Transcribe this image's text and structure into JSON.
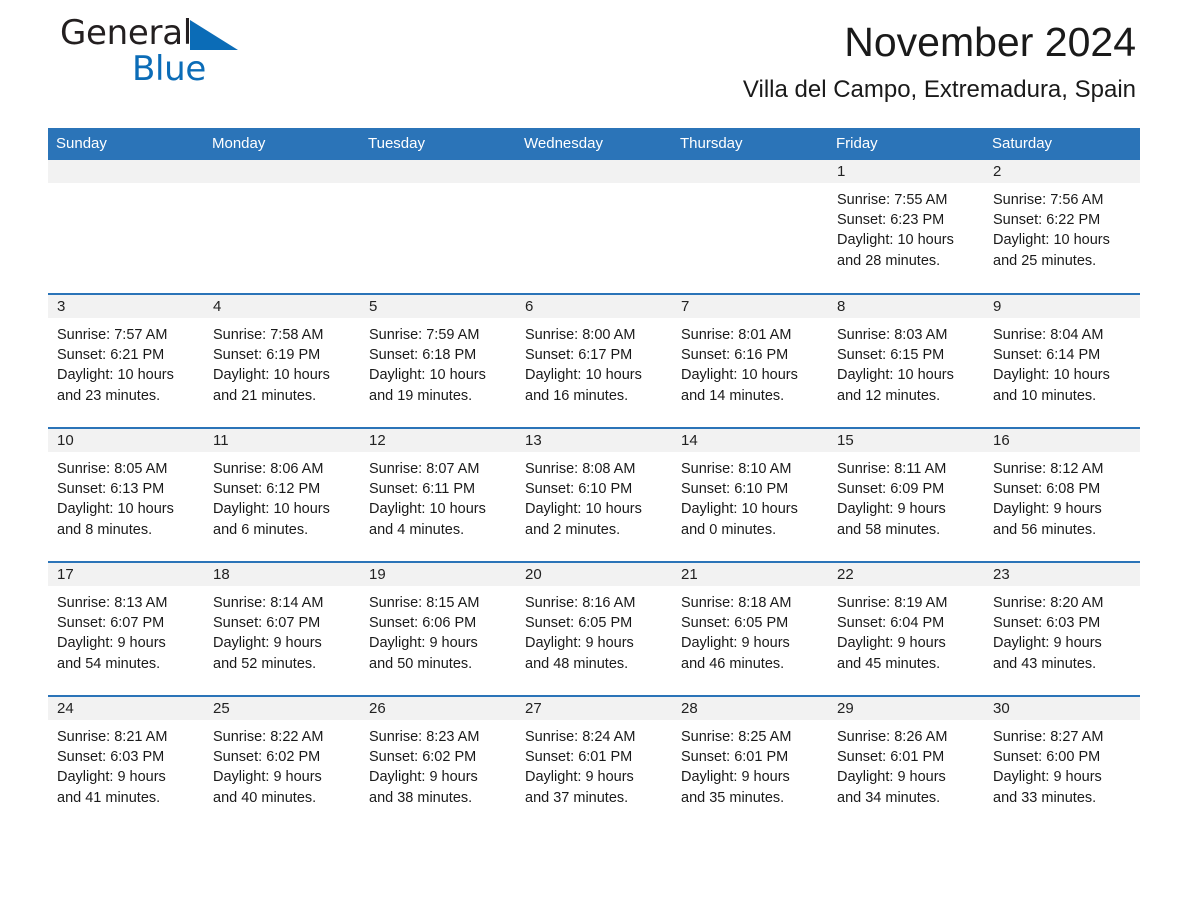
{
  "brand": {
    "name_part1": "General",
    "name_part2": "Blue",
    "accent_color": "#0b6cb7"
  },
  "header": {
    "title": "November 2024",
    "subtitle": "Villa del Campo, Extremadura, Spain"
  },
  "calendar": {
    "header_bg": "#2b74b8",
    "daynum_bg": "#f2f2f2",
    "weekdays": [
      "Sunday",
      "Monday",
      "Tuesday",
      "Wednesday",
      "Thursday",
      "Friday",
      "Saturday"
    ],
    "weeks": [
      [
        {
          "day": "",
          "sunrise": "",
          "sunset": "",
          "daylight1": "",
          "daylight2": ""
        },
        {
          "day": "",
          "sunrise": "",
          "sunset": "",
          "daylight1": "",
          "daylight2": ""
        },
        {
          "day": "",
          "sunrise": "",
          "sunset": "",
          "daylight1": "",
          "daylight2": ""
        },
        {
          "day": "",
          "sunrise": "",
          "sunset": "",
          "daylight1": "",
          "daylight2": ""
        },
        {
          "day": "",
          "sunrise": "",
          "sunset": "",
          "daylight1": "",
          "daylight2": ""
        },
        {
          "day": "1",
          "sunrise": "Sunrise: 7:55 AM",
          "sunset": "Sunset: 6:23 PM",
          "daylight1": "Daylight: 10 hours",
          "daylight2": "and 28 minutes."
        },
        {
          "day": "2",
          "sunrise": "Sunrise: 7:56 AM",
          "sunset": "Sunset: 6:22 PM",
          "daylight1": "Daylight: 10 hours",
          "daylight2": "and 25 minutes."
        }
      ],
      [
        {
          "day": "3",
          "sunrise": "Sunrise: 7:57 AM",
          "sunset": "Sunset: 6:21 PM",
          "daylight1": "Daylight: 10 hours",
          "daylight2": "and 23 minutes."
        },
        {
          "day": "4",
          "sunrise": "Sunrise: 7:58 AM",
          "sunset": "Sunset: 6:19 PM",
          "daylight1": "Daylight: 10 hours",
          "daylight2": "and 21 minutes."
        },
        {
          "day": "5",
          "sunrise": "Sunrise: 7:59 AM",
          "sunset": "Sunset: 6:18 PM",
          "daylight1": "Daylight: 10 hours",
          "daylight2": "and 19 minutes."
        },
        {
          "day": "6",
          "sunrise": "Sunrise: 8:00 AM",
          "sunset": "Sunset: 6:17 PM",
          "daylight1": "Daylight: 10 hours",
          "daylight2": "and 16 minutes."
        },
        {
          "day": "7",
          "sunrise": "Sunrise: 8:01 AM",
          "sunset": "Sunset: 6:16 PM",
          "daylight1": "Daylight: 10 hours",
          "daylight2": "and 14 minutes."
        },
        {
          "day": "8",
          "sunrise": "Sunrise: 8:03 AM",
          "sunset": "Sunset: 6:15 PM",
          "daylight1": "Daylight: 10 hours",
          "daylight2": "and 12 minutes."
        },
        {
          "day": "9",
          "sunrise": "Sunrise: 8:04 AM",
          "sunset": "Sunset: 6:14 PM",
          "daylight1": "Daylight: 10 hours",
          "daylight2": "and 10 minutes."
        }
      ],
      [
        {
          "day": "10",
          "sunrise": "Sunrise: 8:05 AM",
          "sunset": "Sunset: 6:13 PM",
          "daylight1": "Daylight: 10 hours",
          "daylight2": "and 8 minutes."
        },
        {
          "day": "11",
          "sunrise": "Sunrise: 8:06 AM",
          "sunset": "Sunset: 6:12 PM",
          "daylight1": "Daylight: 10 hours",
          "daylight2": "and 6 minutes."
        },
        {
          "day": "12",
          "sunrise": "Sunrise: 8:07 AM",
          "sunset": "Sunset: 6:11 PM",
          "daylight1": "Daylight: 10 hours",
          "daylight2": "and 4 minutes."
        },
        {
          "day": "13",
          "sunrise": "Sunrise: 8:08 AM",
          "sunset": "Sunset: 6:10 PM",
          "daylight1": "Daylight: 10 hours",
          "daylight2": "and 2 minutes."
        },
        {
          "day": "14",
          "sunrise": "Sunrise: 8:10 AM",
          "sunset": "Sunset: 6:10 PM",
          "daylight1": "Daylight: 10 hours",
          "daylight2": "and 0 minutes."
        },
        {
          "day": "15",
          "sunrise": "Sunrise: 8:11 AM",
          "sunset": "Sunset: 6:09 PM",
          "daylight1": "Daylight: 9 hours",
          "daylight2": "and 58 minutes."
        },
        {
          "day": "16",
          "sunrise": "Sunrise: 8:12 AM",
          "sunset": "Sunset: 6:08 PM",
          "daylight1": "Daylight: 9 hours",
          "daylight2": "and 56 minutes."
        }
      ],
      [
        {
          "day": "17",
          "sunrise": "Sunrise: 8:13 AM",
          "sunset": "Sunset: 6:07 PM",
          "daylight1": "Daylight: 9 hours",
          "daylight2": "and 54 minutes."
        },
        {
          "day": "18",
          "sunrise": "Sunrise: 8:14 AM",
          "sunset": "Sunset: 6:07 PM",
          "daylight1": "Daylight: 9 hours",
          "daylight2": "and 52 minutes."
        },
        {
          "day": "19",
          "sunrise": "Sunrise: 8:15 AM",
          "sunset": "Sunset: 6:06 PM",
          "daylight1": "Daylight: 9 hours",
          "daylight2": "and 50 minutes."
        },
        {
          "day": "20",
          "sunrise": "Sunrise: 8:16 AM",
          "sunset": "Sunset: 6:05 PM",
          "daylight1": "Daylight: 9 hours",
          "daylight2": "and 48 minutes."
        },
        {
          "day": "21",
          "sunrise": "Sunrise: 8:18 AM",
          "sunset": "Sunset: 6:05 PM",
          "daylight1": "Daylight: 9 hours",
          "daylight2": "and 46 minutes."
        },
        {
          "day": "22",
          "sunrise": "Sunrise: 8:19 AM",
          "sunset": "Sunset: 6:04 PM",
          "daylight1": "Daylight: 9 hours",
          "daylight2": "and 45 minutes."
        },
        {
          "day": "23",
          "sunrise": "Sunrise: 8:20 AM",
          "sunset": "Sunset: 6:03 PM",
          "daylight1": "Daylight: 9 hours",
          "daylight2": "and 43 minutes."
        }
      ],
      [
        {
          "day": "24",
          "sunrise": "Sunrise: 8:21 AM",
          "sunset": "Sunset: 6:03 PM",
          "daylight1": "Daylight: 9 hours",
          "daylight2": "and 41 minutes."
        },
        {
          "day": "25",
          "sunrise": "Sunrise: 8:22 AM",
          "sunset": "Sunset: 6:02 PM",
          "daylight1": "Daylight: 9 hours",
          "daylight2": "and 40 minutes."
        },
        {
          "day": "26",
          "sunrise": "Sunrise: 8:23 AM",
          "sunset": "Sunset: 6:02 PM",
          "daylight1": "Daylight: 9 hours",
          "daylight2": "and 38 minutes."
        },
        {
          "day": "27",
          "sunrise": "Sunrise: 8:24 AM",
          "sunset": "Sunset: 6:01 PM",
          "daylight1": "Daylight: 9 hours",
          "daylight2": "and 37 minutes."
        },
        {
          "day": "28",
          "sunrise": "Sunrise: 8:25 AM",
          "sunset": "Sunset: 6:01 PM",
          "daylight1": "Daylight: 9 hours",
          "daylight2": "and 35 minutes."
        },
        {
          "day": "29",
          "sunrise": "Sunrise: 8:26 AM",
          "sunset": "Sunset: 6:01 PM",
          "daylight1": "Daylight: 9 hours",
          "daylight2": "and 34 minutes."
        },
        {
          "day": "30",
          "sunrise": "Sunrise: 8:27 AM",
          "sunset": "Sunset: 6:00 PM",
          "daylight1": "Daylight: 9 hours",
          "daylight2": "and 33 minutes."
        }
      ]
    ]
  }
}
